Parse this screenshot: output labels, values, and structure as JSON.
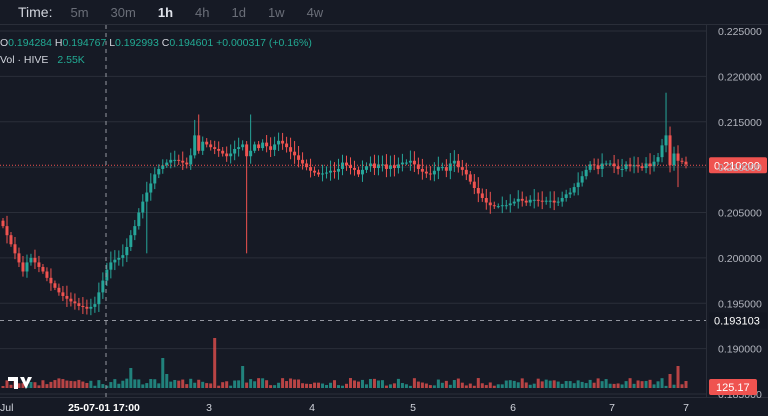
{
  "toolbar": {
    "label": "Time:",
    "timeframes": [
      "5m",
      "30m",
      "1h",
      "4h",
      "1d",
      "1w",
      "4w"
    ],
    "active": "1h"
  },
  "legend": {
    "o_label": "O",
    "o": "0.194284",
    "h_label": "H",
    "h": "0.194767",
    "l_label": "L",
    "l": "0.192993",
    "c_label": "C",
    "c": "0.194601",
    "change": "+0.000317 (+0.16%)",
    "vol_label": "Vol · HIVE",
    "vol_value": "2.55K"
  },
  "colors": {
    "up": "#26a69a",
    "down": "#ef5350",
    "bg": "#161a25",
    "grid": "#2a2e39"
  },
  "chart_data": {
    "type": "candlestick",
    "y_ticks": [
      "0.225000",
      "0.220000",
      "0.215000",
      "0.210000",
      "0.205000",
      "0.200000",
      "0.195000",
      "0.190000",
      "0.185000"
    ],
    "ylim": [
      0.1816,
      0.2256
    ],
    "x_ticks": [
      "Jul",
      "25-07-01 17:00",
      "3",
      "4",
      "5",
      "6",
      "7",
      "7"
    ],
    "current_price": "0.210200",
    "crosshair_price": "0.193103",
    "volume_label": "125.17",
    "closes": [
      0.2035,
      0.2025,
      0.2015,
      0.2005,
      0.1995,
      0.1985,
      0.1995,
      0.2,
      0.1995,
      0.199,
      0.1985,
      0.1978,
      0.1972,
      0.1967,
      0.1962,
      0.1958,
      0.1955,
      0.1952,
      0.195,
      0.1947,
      0.1946,
      0.1944,
      0.1946,
      0.1949,
      0.1962,
      0.1975,
      0.1987,
      0.1995,
      0.1998,
      0.2,
      0.2003,
      0.2012,
      0.2025,
      0.2035,
      0.205,
      0.2062,
      0.2072,
      0.2082,
      0.2092,
      0.2098,
      0.2102,
      0.2105,
      0.2108,
      0.2108,
      0.2107,
      0.2105,
      0.2103,
      0.2113,
      0.2135,
      0.2118,
      0.2128,
      0.2125,
      0.2122,
      0.212,
      0.2118,
      0.2115,
      0.2112,
      0.2115,
      0.212,
      0.2122,
      0.2125,
      0.2112,
      0.2118,
      0.2125,
      0.2121,
      0.2127,
      0.2123,
      0.2119,
      0.2125,
      0.2129,
      0.2126,
      0.2122,
      0.2117,
      0.2113,
      0.2108,
      0.2104,
      0.21,
      0.2096,
      0.2094,
      0.2092,
      0.2093,
      0.2094,
      0.2096,
      0.2095,
      0.2098,
      0.2105,
      0.2102,
      0.2099,
      0.2097,
      0.2092,
      0.2097,
      0.2101,
      0.2104,
      0.2099,
      0.2103,
      0.2103,
      0.2098,
      0.2102,
      0.2099,
      0.2103,
      0.2105,
      0.2105,
      0.2107,
      0.2103,
      0.2098,
      0.2095,
      0.2093,
      0.2092,
      0.2096,
      0.21,
      0.21,
      0.2096,
      0.2104,
      0.2107,
      0.21,
      0.2097,
      0.2092,
      0.2084,
      0.2077,
      0.2071,
      0.2066,
      0.2061,
      0.2058,
      0.2057,
      0.2057,
      0.2058,
      0.2058,
      0.206,
      0.2062,
      0.2065,
      0.2063,
      0.2061,
      0.2064,
      0.2064,
      0.2063,
      0.2062,
      0.2063,
      0.2063,
      0.2061,
      0.2062,
      0.2066,
      0.207,
      0.2072,
      0.2078,
      0.2083,
      0.209,
      0.2097,
      0.2103,
      0.2102,
      0.2098,
      0.2104,
      0.2104,
      0.2104,
      0.2101,
      0.2098,
      0.2098,
      0.2103,
      0.2101,
      0.2102,
      0.2101,
      0.2099,
      0.2104,
      0.2101,
      0.2106,
      0.2111,
      0.2124,
      0.2135,
      0.2102,
      0.2115,
      0.2107,
      0.2106,
      0.2103
    ]
  }
}
